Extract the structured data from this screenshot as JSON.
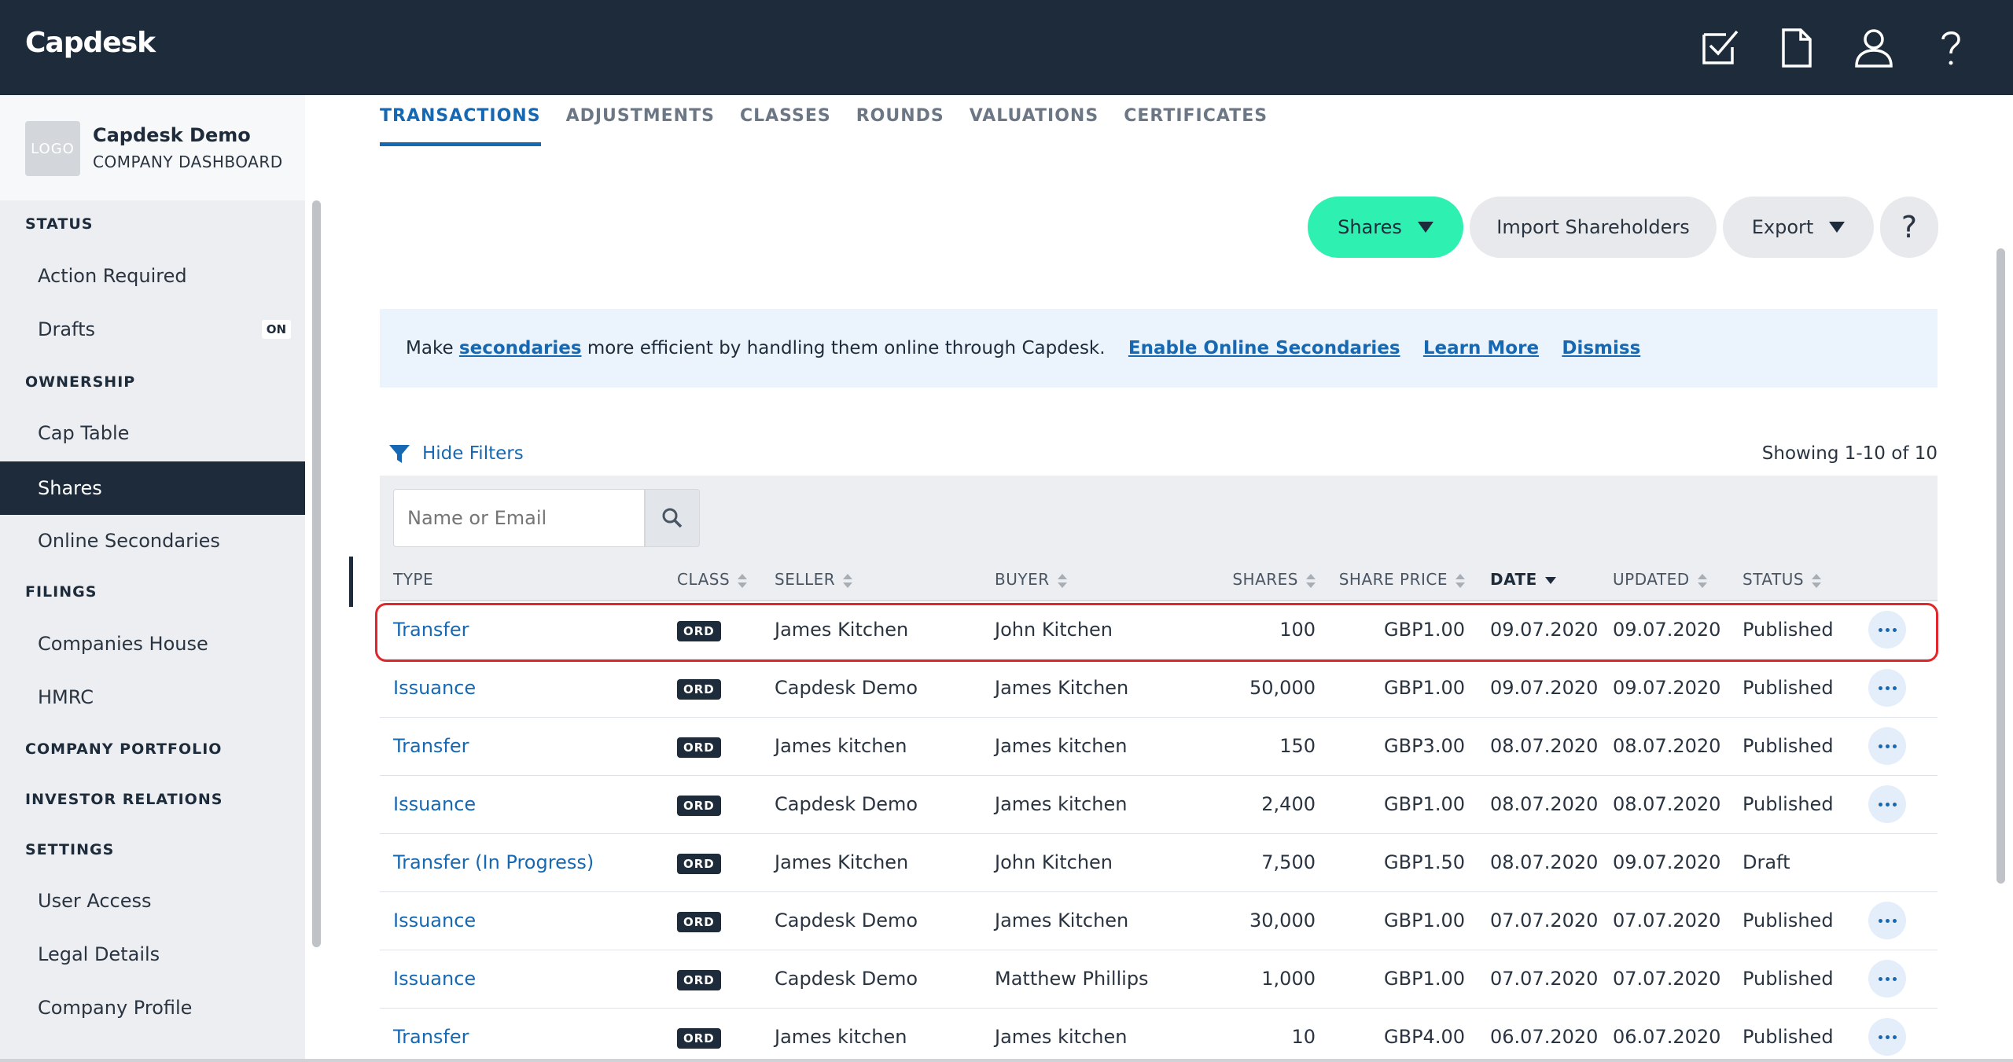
{
  "app": {
    "logo": "Capdesk",
    "icons": [
      "checklist-icon",
      "document-icon",
      "user-icon",
      "help-icon"
    ]
  },
  "company": {
    "logo_placeholder": "LOGO",
    "name": "Capdesk Demo",
    "subtitle": "COMPANY DASHBOARD"
  },
  "sidebar": {
    "sections": {
      "status": "STATUS",
      "ownership": "OWNERSHIP",
      "filings": "FILINGS",
      "portfolio": "COMPANY PORTFOLIO",
      "investor": "INVESTOR RELATIONS",
      "settings": "SETTINGS"
    },
    "items": {
      "action_required": "Action Required",
      "drafts": "Drafts",
      "drafts_badge": "ON",
      "cap_table": "Cap Table",
      "shares": "Shares",
      "online_secondaries": "Online Secondaries",
      "companies_house": "Companies House",
      "hmrc": "HMRC",
      "user_access": "User Access",
      "legal_details": "Legal Details",
      "company_profile": "Company Profile"
    }
  },
  "tabs": [
    "TRANSACTIONS",
    "ADJUSTMENTS",
    "CLASSES",
    "ROUNDS",
    "VALUATIONS",
    "CERTIFICATES"
  ],
  "actions": {
    "shares": "Shares",
    "import": "Import Shareholders",
    "export": "Export",
    "help": "?"
  },
  "banner": {
    "text_before": "Make ",
    "secondaries_link": "secondaries",
    "text_after": " more efficient by handling them online through Capdesk.",
    "enable": "Enable Online Secondaries",
    "learn": "Learn More",
    "dismiss": "Dismiss"
  },
  "filters": {
    "hide_label": "Hide Filters",
    "showing": "Showing 1-10 of 10",
    "search_placeholder": "Name or Email"
  },
  "table": {
    "headers": {
      "type": "TYPE",
      "class": "CLASS",
      "seller": "SELLER",
      "buyer": "BUYER",
      "shares": "SHARES",
      "share_price": "SHARE PRICE",
      "date": "DATE",
      "updated": "UPDATED",
      "status": "STATUS"
    },
    "rows": [
      {
        "type": "Transfer",
        "class": "ORD",
        "seller": "James Kitchen",
        "buyer": "John Kitchen",
        "shares": "100",
        "price": "GBP1.00",
        "date": "09.07.2020",
        "updated": "09.07.2020",
        "status": "Published"
      },
      {
        "type": "Issuance",
        "class": "ORD",
        "seller": "Capdesk Demo",
        "buyer": "James Kitchen",
        "shares": "50,000",
        "price": "GBP1.00",
        "date": "09.07.2020",
        "updated": "09.07.2020",
        "status": "Published"
      },
      {
        "type": "Transfer",
        "class": "ORD",
        "seller": "James kitchen",
        "buyer": "James kitchen",
        "shares": "150",
        "price": "GBP3.00",
        "date": "08.07.2020",
        "updated": "08.07.2020",
        "status": "Published"
      },
      {
        "type": "Issuance",
        "class": "ORD",
        "seller": "Capdesk Demo",
        "buyer": "James kitchen",
        "shares": "2,400",
        "price": "GBP1.00",
        "date": "08.07.2020",
        "updated": "08.07.2020",
        "status": "Published"
      },
      {
        "type": "Transfer (In Progress)",
        "class": "ORD",
        "seller": "James Kitchen",
        "buyer": "John Kitchen",
        "shares": "7,500",
        "price": "GBP1.50",
        "date": "08.07.2020",
        "updated": "09.07.2020",
        "status": "Draft"
      },
      {
        "type": "Issuance",
        "class": "ORD",
        "seller": "Capdesk Demo",
        "buyer": "James Kitchen",
        "shares": "30,000",
        "price": "GBP1.00",
        "date": "07.07.2020",
        "updated": "07.07.2020",
        "status": "Published"
      },
      {
        "type": "Issuance",
        "class": "ORD",
        "seller": "Capdesk Demo",
        "buyer": "Matthew Phillips",
        "shares": "1,000",
        "price": "GBP1.00",
        "date": "07.07.2020",
        "updated": "07.07.2020",
        "status": "Published"
      },
      {
        "type": "Transfer",
        "class": "ORD",
        "seller": "James kitchen",
        "buyer": "James kitchen",
        "shares": "10",
        "price": "GBP4.00",
        "date": "06.07.2020",
        "updated": "06.07.2020",
        "status": "Published"
      }
    ]
  },
  "colors": {
    "topbar": "#1d2b3a",
    "accent": "#2ef0b1",
    "link": "#1768b3",
    "highlight": "#e0272b"
  }
}
